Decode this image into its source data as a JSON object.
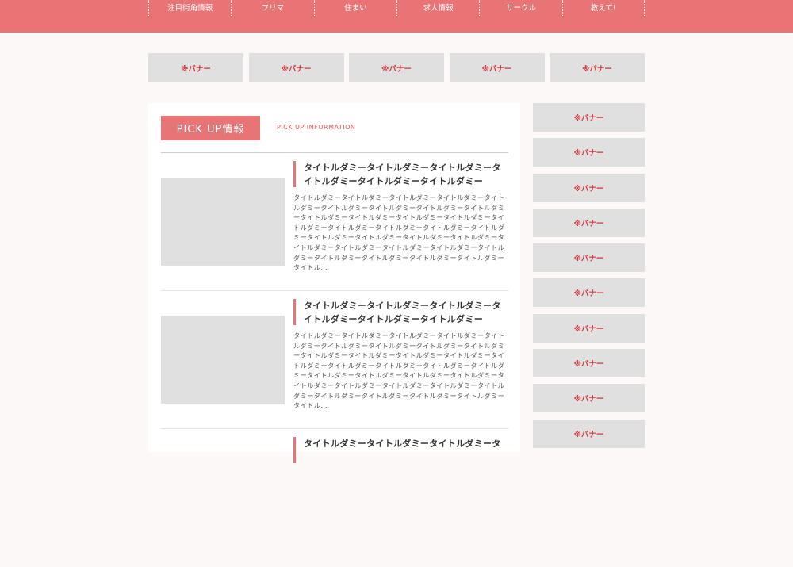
{
  "nav": {
    "items": [
      "注目街角情報",
      "フリマ",
      "住まい",
      "求人情報",
      "サークル",
      "教えて!"
    ]
  },
  "banners": {
    "top": [
      "※バナー",
      "※バナー",
      "※バナー",
      "※バナー",
      "※バナー"
    ],
    "side": [
      "※バナー",
      "※バナー",
      "※バナー",
      "※バナー",
      "※バナー",
      "※バナー",
      "※バナー",
      "※バナー",
      "※バナー",
      "※バナー"
    ]
  },
  "pickup": {
    "badge": "PICK UP情報",
    "subtitle": "PICK UP INFORMATION",
    "articles": [
      {
        "title": "タイトルダミータイトルダミータイトルダミータイトルダミータイトルダミータイトルダミー",
        "body": "タイトルダミータイトルダミータイトルダミータイトルダミータイトルダミータイトルダミータイトルダミータイトルダミータイトルダミータイトルダミータイトルダミータイトルダミータイトルダミータイトルダミータイトルダミータイトルダミータイトルダミータイトルダミータイトルダミータイトルダミータイトルダミータイトルダミータイトルダミータイトルダミータイトルダミータイトルダミータイトルダミータイトルダミータイトルダミータイトルダミータイトルダミータイトル…"
      },
      {
        "title": "タイトルダミータイトルダミータイトルダミータイトルダミータイトルダミータイトルダミー",
        "body": "タイトルダミータイトルダミータイトルダミータイトルダミータイトルダミータイトルダミータイトルダミータイトルダミータイトルダミータイトルダミータイトルダミータイトルダミータイトルダミータイトルダミータイトルダミータイトルダミータイトルダミータイトルダミータイトルダミータイトルダミータイトルダミータイトルダミータイトルダミータイトルダミータイトルダミータイトルダミータイトルダミータイトルダミータイトルダミータイトルダミータイトルダミータイトル…"
      },
      {
        "title": "タイトルダミータイトルダミータイトルダミータ",
        "body": ""
      }
    ]
  }
}
